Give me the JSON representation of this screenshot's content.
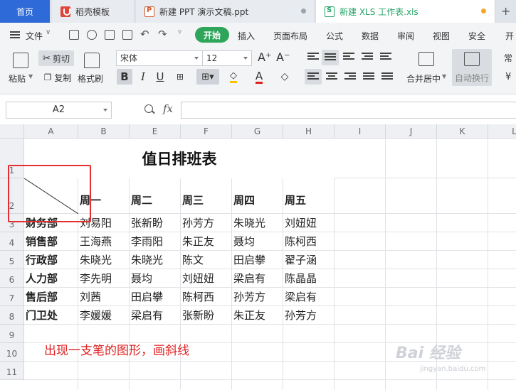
{
  "tabs": [
    {
      "label": "首页"
    },
    {
      "label": "稻壳模板"
    },
    {
      "label": "新建 PPT 演示文稿.ppt"
    },
    {
      "label": "新建 XLS 工作表.xls"
    }
  ],
  "menu": {
    "file": "文件",
    "items": [
      "开始",
      "插入",
      "页面布局",
      "公式",
      "数据",
      "审阅",
      "视图",
      "安全",
      "开"
    ]
  },
  "ribbon": {
    "paste": "粘贴",
    "cut": "剪切",
    "copy": "复制",
    "format_painter": "格式刷",
    "font_name": "宋体",
    "font_size": "12",
    "merge_center": "合并居中",
    "auto_wrap": "自动换行",
    "right_clip": "常"
  },
  "formula_bar": {
    "name_box": "A2",
    "fx": "fx",
    "content": ""
  },
  "columns": [
    "A",
    "B",
    "E",
    "F",
    "G",
    "H",
    "I",
    "J",
    "K",
    "L"
  ],
  "rows": [
    "1",
    "2",
    "3",
    "4",
    "5",
    "6",
    "7",
    "8",
    "9",
    "10",
    "11"
  ],
  "sheet": {
    "title": "值日排班表",
    "weekdays": [
      "周一",
      "周二",
      "周三",
      "周四",
      "周五"
    ],
    "departments": [
      {
        "name": "财务部",
        "staff": [
          "刘易阳",
          "张新盼",
          "孙芳方",
          "朱晓光",
          "刘妞妞"
        ]
      },
      {
        "name": "销售部",
        "staff": [
          "王海燕",
          "李雨阳",
          "朱正友",
          "聂均",
          "陈柯西"
        ]
      },
      {
        "name": "行政部",
        "staff": [
          "朱晓光",
          "朱晓光",
          "陈文",
          "田启攀",
          "翟子涵"
        ]
      },
      {
        "name": "人力部",
        "staff": [
          "李先明",
          "聂均",
          "刘妞妞",
          "梁启有",
          "陈晶晶"
        ]
      },
      {
        "name": "售后部",
        "staff": [
          "刘茜",
          "田启攀",
          "陈柯西",
          "孙芳方",
          "梁启有"
        ]
      },
      {
        "name": "门卫处",
        "staff": [
          "李媛媛",
          "梁启有",
          "张新盼",
          "朱正友",
          "孙芳方"
        ]
      }
    ]
  },
  "annotation": "出现一支笔的图形，画斜线",
  "watermark": "Bai 经验",
  "watermark_sub": "jingyan.baidu.com",
  "colors": {
    "home_tab": "#2f6bd8",
    "start_pill": "#2ea55a",
    "annotation_red": "#e02020"
  }
}
